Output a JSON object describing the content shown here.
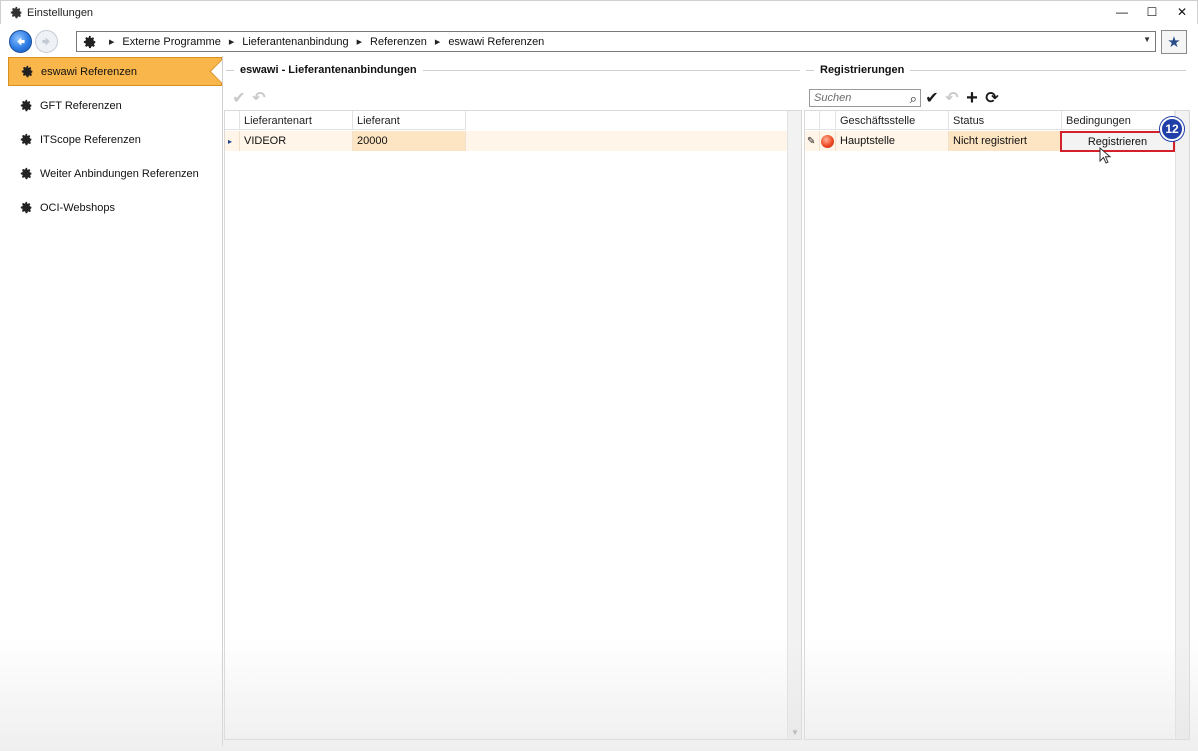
{
  "window": {
    "title": "Einstellungen",
    "minimize": "—",
    "maximize": "☐",
    "close": "✕"
  },
  "breadcrumb": [
    "Externe Programme",
    "Lieferantenanbindung",
    "Referenzen",
    "eswawi Referenzen"
  ],
  "sidebar": {
    "items": [
      {
        "label": "eswawi Referenzen",
        "active": true
      },
      {
        "label": "GFT Referenzen",
        "active": false
      },
      {
        "label": "ITScope Referenzen",
        "active": false
      },
      {
        "label": "Weiter Anbindungen Referenzen",
        "active": false
      },
      {
        "label": "OCI-Webshops",
        "active": false
      }
    ]
  },
  "left_panel": {
    "title": "eswawi - Lieferantenanbindungen",
    "columns": [
      "Lieferantenart",
      "Lieferant"
    ],
    "rows": [
      {
        "indicator": "▸",
        "lieferantenart": "VIDEOR",
        "lieferant": "20000"
      }
    ]
  },
  "right_panel": {
    "title": "Registrierungen",
    "search_placeholder": "Suchen",
    "columns": [
      "Geschäftsstelle",
      "Status",
      "Bedingungen"
    ],
    "rows": [
      {
        "geschaeftsstelle": "Hauptstelle",
        "status": "Nicht registriert",
        "action": "Registrieren"
      }
    ]
  },
  "annotation": {
    "step": "12"
  },
  "colors": {
    "active_tab": "#f9b64b",
    "highlight": "#d3202a",
    "badge": "#1f3ea8",
    "status_dot": "#ef4a23"
  }
}
